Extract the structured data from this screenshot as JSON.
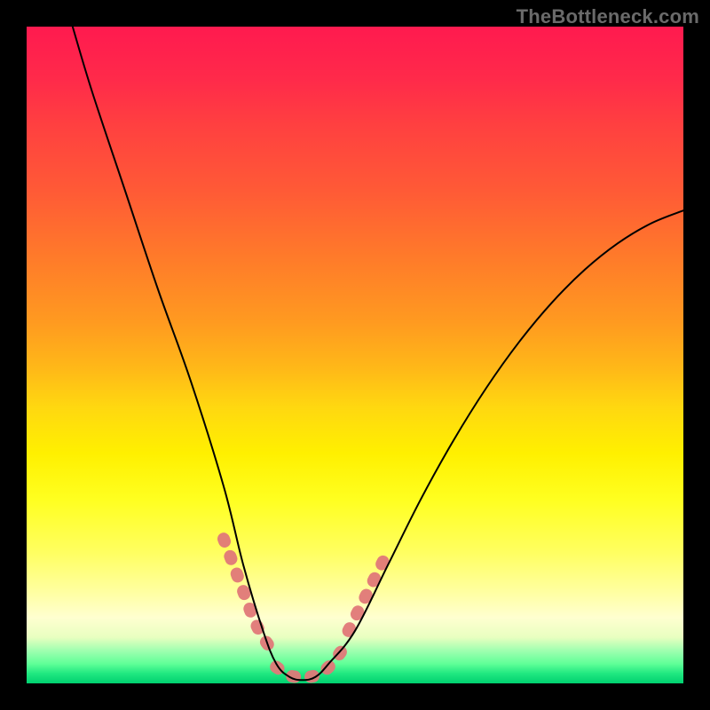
{
  "watermark": "TheBottleneck.com",
  "chart_data": {
    "type": "line",
    "title": "",
    "xlabel": "",
    "ylabel": "",
    "xlim": [
      0,
      100
    ],
    "ylim": [
      0,
      100
    ],
    "grid": false,
    "legend": false,
    "background_gradient": {
      "orientation": "vertical",
      "stops": [
        {
          "pos": 0,
          "color": "#ff1a4f"
        },
        {
          "pos": 50,
          "color": "#ffd018"
        },
        {
          "pos": 80,
          "color": "#ffff80"
        },
        {
          "pos": 100,
          "color": "#00d070"
        }
      ]
    },
    "series": [
      {
        "name": "bottleneck-curve",
        "x": [
          7,
          10,
          15,
          20,
          25,
          30,
          33,
          36,
          38,
          40,
          42,
          44,
          46,
          50,
          55,
          60,
          65,
          70,
          75,
          80,
          85,
          90,
          95,
          100
        ],
        "y": [
          100,
          90,
          75,
          60,
          46,
          30,
          18,
          8,
          3,
          1,
          0.5,
          1,
          3,
          8,
          18,
          28,
          37,
          45,
          52,
          58,
          63,
          67,
          70,
          72
        ]
      }
    ],
    "highlight_segments": [
      {
        "name": "left-pink-band",
        "x": [
          30,
          31.5,
          33,
          34.5,
          36,
          37.5
        ],
        "y": [
          22,
          18,
          14,
          10,
          7,
          5
        ],
        "color": "#e07878",
        "width": 14
      },
      {
        "name": "bottom-pink-band",
        "x": [
          38,
          40,
          42,
          44,
          46,
          48
        ],
        "y": [
          2.5,
          1.2,
          1,
          1.2,
          2.5,
          5
        ],
        "color": "#e07878",
        "width": 14
      },
      {
        "name": "right-pink-band",
        "x": [
          49,
          51,
          53,
          55
        ],
        "y": [
          8,
          12,
          16,
          20
        ],
        "color": "#e07878",
        "width": 14
      }
    ]
  }
}
